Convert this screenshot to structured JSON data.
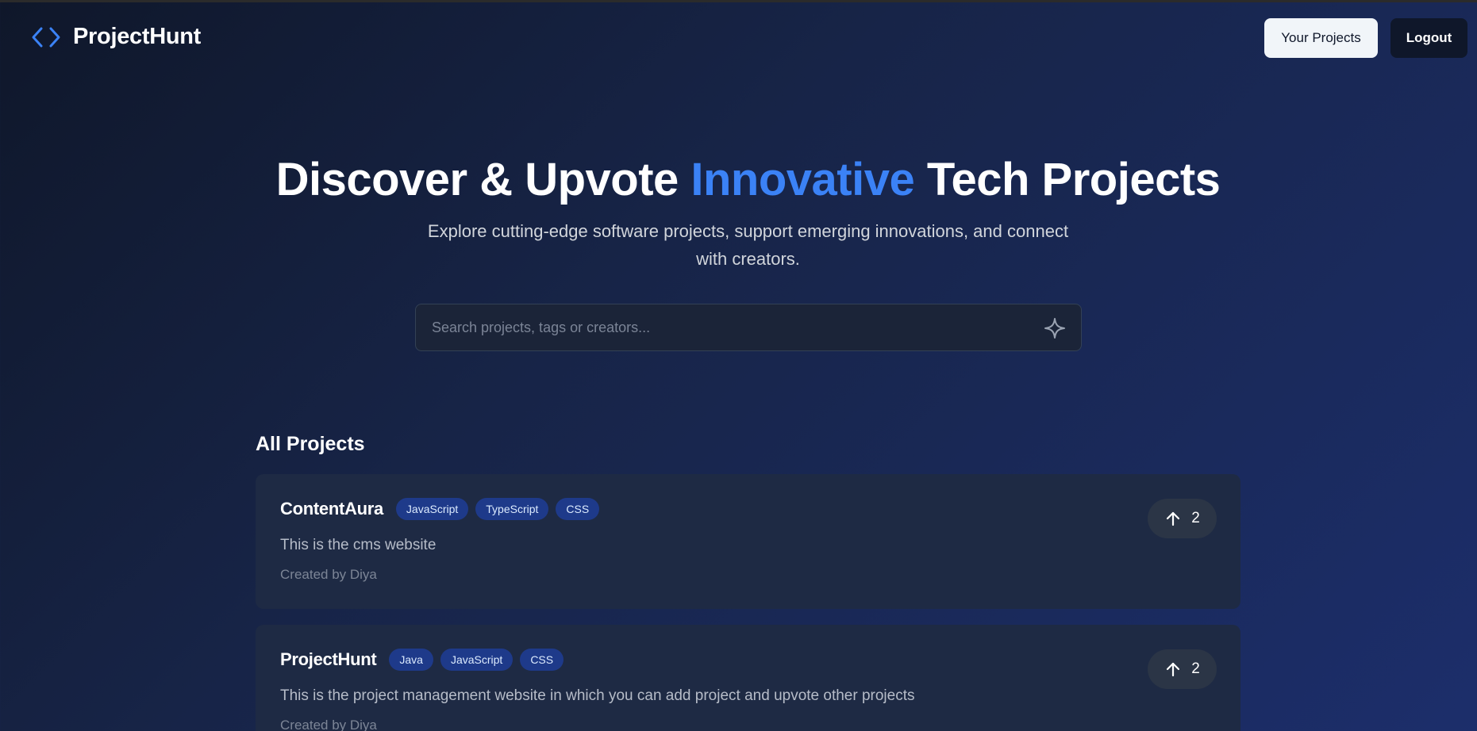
{
  "brand": {
    "name": "ProjectHunt"
  },
  "nav": {
    "your_projects": "Your Projects",
    "logout": "Logout"
  },
  "hero": {
    "title_part1": "Discover & Upvote ",
    "title_accent": "Innovative",
    "title_part2": " Tech Projects",
    "subtitle": "Explore cutting-edge software projects, support emerging innovations, and connect with creators."
  },
  "search": {
    "placeholder": "Search projects, tags or creators...",
    "value": ""
  },
  "projects_section": {
    "title": "All Projects",
    "projects": [
      {
        "name": "ContentAura",
        "tags": [
          "JavaScript",
          "TypeScript",
          "CSS"
        ],
        "description": "This is the cms website",
        "creator": "Created by Diya",
        "votes": "2"
      },
      {
        "name": "ProjectHunt",
        "tags": [
          "Java",
          "JavaScript",
          "CSS"
        ],
        "description": "This is the project management website in which you can add project and upvote other projects",
        "creator": "Created by Diya",
        "votes": "2"
      }
    ]
  },
  "colors": {
    "accent": "#3b82f6",
    "tag_bg": "#1e3a8a",
    "card_bg": "#1e2a44"
  },
  "icons": {
    "brand": "code-brackets-icon",
    "search": "sparkle-icon",
    "vote": "arrow-up-icon"
  }
}
